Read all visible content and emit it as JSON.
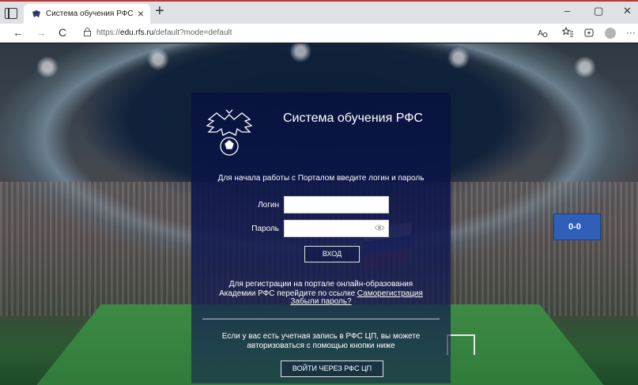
{
  "browser": {
    "tab_title": "Система обучения РФС",
    "tab_close": "×",
    "new_tab": "+",
    "url_prefix": "https://",
    "url_host": "edu.rfs.ru",
    "url_path": "/default?mode=default",
    "window_minimize": "–",
    "window_restore": "▢",
    "window_close": "✕",
    "nav_back": "←",
    "nav_forward": "→",
    "nav_reload": "C",
    "more_menu": "···"
  },
  "scoreboard": {
    "score": "0-0"
  },
  "login": {
    "title": "Система обучения РФС",
    "intro": "Для начала работы с Порталом введите логин и пароль",
    "username_label": "Логин",
    "password_label": "Пароль",
    "username_value": "",
    "password_value": "",
    "submit_label": "ВХОД",
    "register_line1": "Для регистрации на портале онлайн-образования",
    "register_line2": "Академии РФС перейдите по ссылке",
    "register_link": "Саморегистрация",
    "forgot_link": "Забыли пароль?",
    "rfs_line1": "Если у вас есть учетная запись в РФС ЦП, вы можете",
    "rfs_line2": "авторизоваться с помощью кнопки ниже",
    "rfs_button": "ВОЙТИ ЧЕРЕЗ РФС ЦП"
  },
  "colors": {
    "panel": "#0e1650",
    "browser_accent": "#b43a3a"
  }
}
